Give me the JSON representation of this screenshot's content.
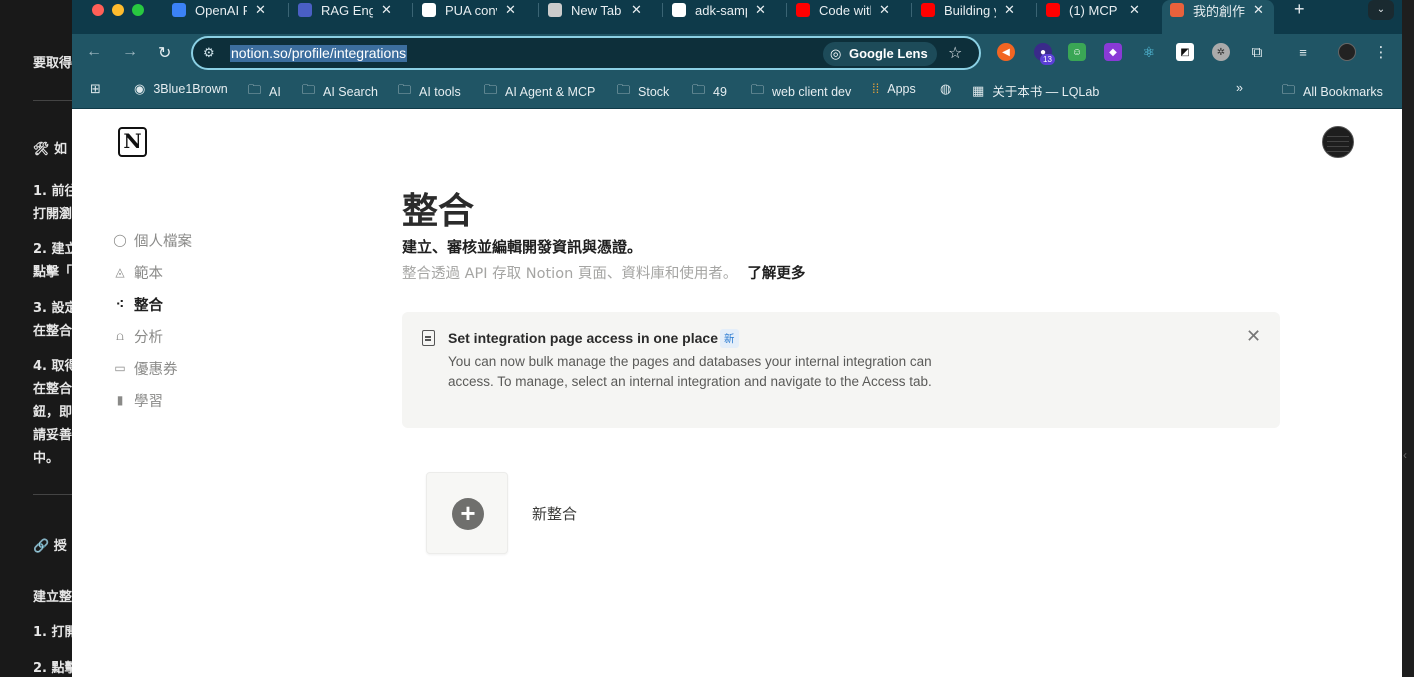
{
  "background_doc": {
    "lines": [
      {
        "text": "要取得"
      },
      {
        "text": "🛠 如"
      },
      {
        "text": "1. 前往"
      },
      {
        "text": "打開瀏"
      },
      {
        "text": "2. 建立"
      },
      {
        "text": "點擊「"
      },
      {
        "text": "3. 設定"
      },
      {
        "text": "在整合"
      },
      {
        "text": "4. 取得"
      },
      {
        "text": "在整合"
      },
      {
        "text": "鈕，即"
      },
      {
        "text": "請妥善"
      },
      {
        "text": "中。"
      },
      {
        "text": "🔗 授"
      },
      {
        "text": "建立整"
      },
      {
        "text": "1. 打開"
      },
      {
        "text": "2. 點擊"
      }
    ]
  },
  "browser": {
    "tabs": [
      {
        "label": "OpenAI P",
        "icon": "openai-icon",
        "color": "#3b82f6"
      },
      {
        "label": "RAG Engi",
        "icon": "rag-icon",
        "color": "#4a5fc4"
      },
      {
        "label": "PUA conv",
        "icon": "pua-icon",
        "color": "#ffffff"
      },
      {
        "label": "New Tab",
        "icon": "chrome-icon",
        "color": "#cccccc"
      },
      {
        "label": "adk-samp",
        "icon": "github-icon",
        "color": "#ffffff"
      },
      {
        "label": "Code with",
        "icon": "youtube-icon",
        "color": "#ff0000"
      },
      {
        "label": "Building y",
        "icon": "youtube-icon",
        "color": "#ff0000"
      },
      {
        "label": "(1) MCP",
        "icon": "youtube-icon",
        "color": "#ff0000"
      },
      {
        "label": "我的創作",
        "icon": "notion-tab-icon",
        "color": "#e8613c",
        "active": true
      }
    ],
    "new_tab": "+",
    "url": "notion.so/profile/integrations",
    "lens_label": "Google Lens",
    "extension_badge": "13",
    "bookmarks": [
      {
        "label": "3Blue1Brown",
        "icon": "3b1b-icon"
      },
      {
        "label": "AI",
        "icon": "folder-icon"
      },
      {
        "label": "AI Search",
        "icon": "folder-icon"
      },
      {
        "label": "AI tools",
        "icon": "folder-icon"
      },
      {
        "label": "AI Agent & MCP",
        "icon": "folder-icon"
      },
      {
        "label": "Stock",
        "icon": "folder-icon"
      },
      {
        "label": "49",
        "icon": "folder-icon"
      },
      {
        "label": "web client dev",
        "icon": "folder-icon"
      },
      {
        "label": "Apps",
        "icon": "apps-grid-icon"
      },
      {
        "label": "",
        "icon": "globe-icon"
      },
      {
        "label": "关于本书 — LQLab",
        "icon": "lqlab-icon"
      }
    ],
    "all_bookmarks": "All Bookmarks",
    "overflow": "»"
  },
  "page": {
    "logo": "N",
    "sidebar": [
      {
        "label": "個人檔案",
        "icon": "profile-icon"
      },
      {
        "label": "範本",
        "icon": "templates-icon"
      },
      {
        "label": "整合",
        "icon": "integrations-icon",
        "active": true
      },
      {
        "label": "分析",
        "icon": "analytics-icon"
      },
      {
        "label": "優惠券",
        "icon": "coupon-icon"
      },
      {
        "label": "學習",
        "icon": "learn-icon"
      }
    ],
    "title": "整合",
    "subtitle": "建立、審核並編輯開發資訊與憑證。",
    "description": "整合透過 API 存取 Notion 頁面、資料庫和使用者。",
    "learn_more": "了解更多",
    "banner": {
      "title": "Set integration page access in one place",
      "badge": "新",
      "body": "You can now bulk manage the pages and databases your internal integration can access. To manage, select an internal integration and navigate to the Access tab.",
      "close": "✕"
    },
    "new_integration": "新整合"
  }
}
